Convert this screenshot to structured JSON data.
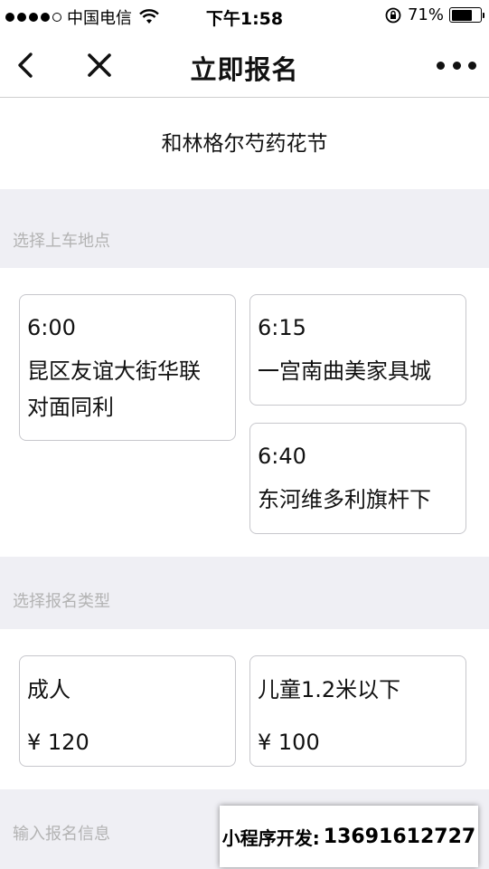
{
  "status_bar": {
    "carrier": "中国电信",
    "time": "下午1:58",
    "battery_percent": "71%",
    "battery_level": 0.71
  },
  "nav": {
    "title": "立即报名"
  },
  "event": {
    "title": "和林格尔芍药花节"
  },
  "sections": {
    "pickup_label": "选择上车地点",
    "type_label": "选择报名类型",
    "info_label": "输入报名信息"
  },
  "pickup_points": [
    {
      "time": "6:00",
      "place_line1": "昆区友谊大街华联",
      "place_line2": "对面同利"
    },
    {
      "time": "6:15",
      "place_line1": "一宫南曲美家具城",
      "place_line2": ""
    },
    {
      "time": "6:40",
      "place_line1": "东河维多利旗杆下",
      "place_line2": ""
    }
  ],
  "ticket_types": [
    {
      "name": "成人",
      "price": "¥ 120"
    },
    {
      "name": "儿童1.2米以下",
      "price": "¥ 100"
    }
  ],
  "promo": {
    "label": "小程序开发:",
    "phone": "13691612727"
  }
}
